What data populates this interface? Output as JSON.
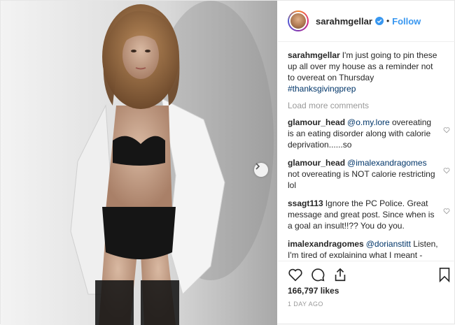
{
  "header": {
    "username": "sarahmgellar",
    "dot": "•",
    "follow_label": "Follow"
  },
  "caption": {
    "user": "sarahmgellar",
    "text": "I'm just going to pin these up all over my house as a reminder not to overeat on Thursday ",
    "hashtag": "#thanksgivingprep"
  },
  "load_more_label": "Load more comments",
  "comments": [
    {
      "user": "glamour_head",
      "mention": "@o.my.lore",
      "text": " overeating is an eating disorder along with calorie deprivation......so"
    },
    {
      "user": "glamour_head",
      "mention": "@imalexandragomes",
      "text": " not overeating is NOT calorie restricting lol"
    },
    {
      "user": "ssagt113",
      "mention": "",
      "text": "Ignore the PC Police. Great message and great post. Since when is a goal an insult!!?? You do you."
    },
    {
      "user": "imalexandragomes",
      "mention": "@dorianstitt",
      "text": " Listen, I'm tired of explaining what I meant - read all my comments if you want. Maybe you just meant that as an example, but fyi you can't know if having two or three plates qualifies as overeating"
    }
  ],
  "likes_label": "166,797 likes",
  "date_label": "1 DAY AGO",
  "icons": {
    "verified": "verified-badge-icon",
    "heart": "heart-icon",
    "comment": "comment-icon",
    "share": "share-icon",
    "bookmark": "bookmark-icon",
    "next": "chevron-right-icon"
  },
  "colors": {
    "link": "#003569",
    "follow": "#3897f0",
    "verified": "#3897f0",
    "muted": "#999999"
  }
}
